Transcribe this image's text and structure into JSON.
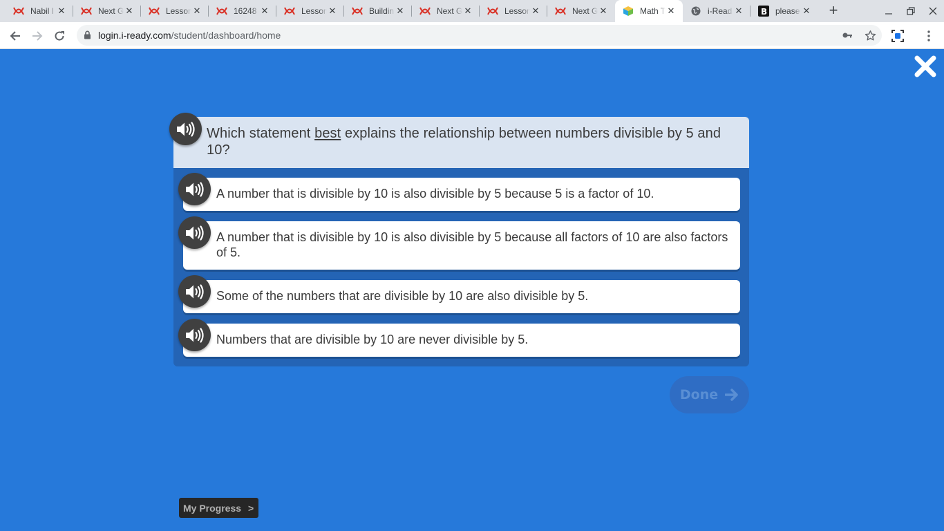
{
  "browser": {
    "tabs": [
      {
        "title": "Nabil I",
        "icon": "brainly-icon"
      },
      {
        "title": "Next G",
        "icon": "brainly-icon"
      },
      {
        "title": "Lesson",
        "icon": "brainly-icon"
      },
      {
        "title": "16248",
        "icon": "brainly-icon"
      },
      {
        "title": "Lesson",
        "icon": "brainly-icon"
      },
      {
        "title": "Buildin",
        "icon": "brainly-icon"
      },
      {
        "title": "Next G",
        "icon": "brainly-icon"
      },
      {
        "title": "Lesson",
        "icon": "brainly-icon"
      },
      {
        "title": "Next G",
        "icon": "brainly-icon"
      },
      {
        "title": "Math T",
        "icon": "iready-cube-icon"
      },
      {
        "title": "i-Read",
        "icon": "globe-icon"
      },
      {
        "title": "please",
        "icon": "letter-b-icon"
      }
    ],
    "active_tab": 9,
    "new_tab_label": "+",
    "url_host": "login.i-ready.com",
    "url_path": "/student/dashboard/home"
  },
  "question": {
    "prompt_before": "Which statement ",
    "prompt_emphasis": "best",
    "prompt_after": " explains the relationship between numbers divisible by 5 and 10?"
  },
  "choices": [
    {
      "text": "A number that is divisible by 10 is also divisible by 5 because 5 is a factor of 10."
    },
    {
      "text": "A number that is divisible by 10 is also divisible by 5 because all factors of 10 are also factors of 5."
    },
    {
      "text": "Some of the numbers that are divisible by 10 are also divisible by 5."
    },
    {
      "text": "Numbers that are divisible by 10 are never divisible by 5."
    }
  ],
  "done_button": {
    "label": "Done"
  },
  "progress_button": {
    "label": "My Progress",
    "chevron": ">"
  },
  "colors": {
    "background": "#2679da",
    "card": "#2464b5",
    "prompt_bg": "#dae4f1",
    "speaker": "#404040",
    "done_disabled": "#2f6dc4"
  }
}
